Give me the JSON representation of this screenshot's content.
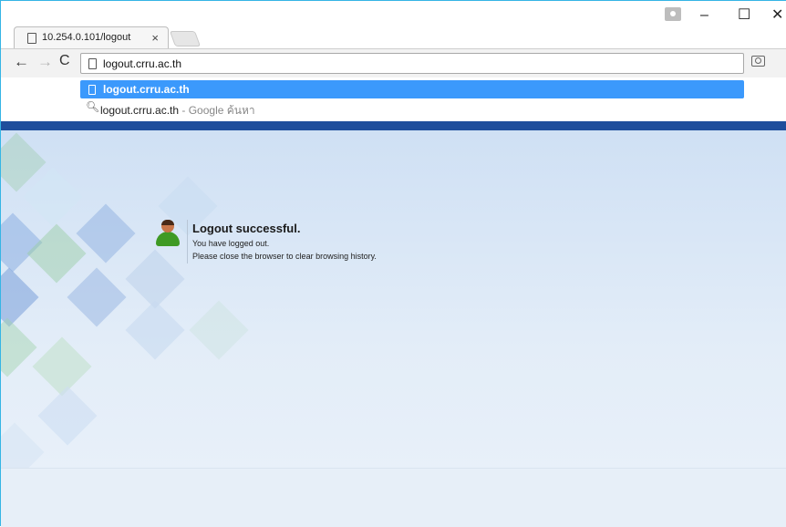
{
  "tab": {
    "title": "10.254.0.101/logout",
    "close": "×"
  },
  "window_controls": {
    "minimize": "–",
    "maximize": "☐",
    "close": "✕"
  },
  "toolbar": {
    "back": "←",
    "forward": "→",
    "reload": "C",
    "menu": "⋮"
  },
  "omnibox": {
    "value": "logout.crru.ac.th"
  },
  "suggestions": [
    {
      "icon": "page-icon",
      "text": "logout.crru.ac.th"
    },
    {
      "icon": "search-icon",
      "text": "logout.crru.ac.th",
      "suffix": " - Google ค้นหา"
    }
  ],
  "page": {
    "heading": "Logout successful.",
    "line1": "You have logged out.",
    "line2": "Please close the browser to clear browsing history."
  },
  "colors": {
    "accent": "#3b99fc",
    "banner": "#1f4e9c",
    "page_bg": "#dce8f6"
  }
}
